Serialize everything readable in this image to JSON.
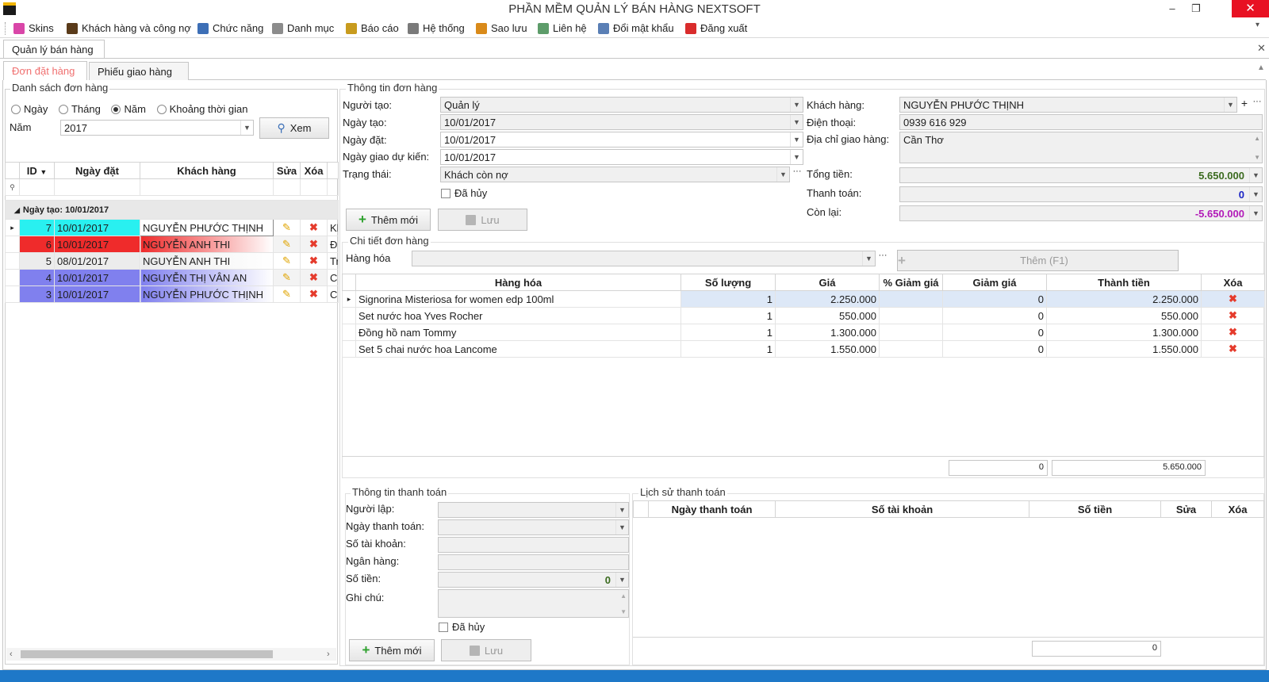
{
  "window": {
    "title": "PHẦN MỀM QUẢN LÝ BÁN HÀNG NEXTSOFT",
    "min": "–",
    "max": "❐",
    "close": "✕"
  },
  "menu": [
    {
      "label": "Skins",
      "icon": "palette-icon",
      "color": "#d946a8"
    },
    {
      "label": "Khách hàng và công nợ",
      "icon": "user-icon",
      "color": "#5a3b1a"
    },
    {
      "label": "Chức năng",
      "icon": "function-icon",
      "color": "#3d6fb6"
    },
    {
      "label": "Danh mục",
      "icon": "list-icon",
      "color": "#8c8c8c"
    },
    {
      "label": "Báo cáo",
      "icon": "report-icon",
      "color": "#c89b1e"
    },
    {
      "label": "Hệ thống",
      "icon": "gears-icon",
      "color": "#7a7a7a"
    },
    {
      "label": "Sao lưu",
      "icon": "backup-icon",
      "color": "#d98a1a"
    },
    {
      "label": "Liên hệ",
      "icon": "contact-icon",
      "color": "#5d9c6a"
    },
    {
      "label": "Đổi mật khẩu",
      "icon": "key-icon",
      "color": "#5a7fb5"
    },
    {
      "label": "Đăng xuất",
      "icon": "logout-icon",
      "color": "#d92c2c"
    }
  ],
  "doc_tab": "Quản lý bán hàng",
  "tabs": {
    "orders": "Đơn đặt hàng",
    "delivery": "Phiếu giao hàng"
  },
  "order_list": {
    "title": "Danh sách đơn hàng",
    "radios": [
      "Ngày",
      "Tháng",
      "Năm",
      "Khoảng thời gian"
    ],
    "year_label": "Năm",
    "year_value": "2017",
    "view_button": "Xem",
    "columns": [
      "ID",
      "Ngày đặt",
      "Khách hàng",
      "Sửa",
      "Xóa"
    ],
    "group_label": "Ngày tạo: 10/01/2017",
    "rows": [
      {
        "id": "7",
        "date": "10/01/2017",
        "customer": "NGUYỄN PHƯỚC THỊNH",
        "extra": "Kh",
        "bg": "#29f0f0"
      },
      {
        "id": "6",
        "date": "10/01/2017",
        "customer": "NGUYỄN ANH THI",
        "extra": "Đã",
        "bg": "#ef2b2b"
      },
      {
        "id": "5",
        "date": "08/01/2017",
        "customer": "NGUYỄN ANH THI",
        "extra": "Tr",
        "bg": "#ececec"
      },
      {
        "id": "4",
        "date": "10/01/2017",
        "customer": "NGUYỄN THỊ VÂN AN",
        "extra": "Ch",
        "bg": "#8080ee"
      },
      {
        "id": "3",
        "date": "10/01/2017",
        "customer": "NGUYỄN PHƯỚC THỊNH",
        "extra": "Ch",
        "bg": "#8080ee"
      }
    ]
  },
  "order_info": {
    "title": "Thông tin đơn hàng",
    "creator_label": "Người tạo:",
    "creator": "Quản lý",
    "created_label": "Ngày tạo:",
    "created": "10/01/2017",
    "order_date_label": "Ngày đặt:",
    "order_date": "10/01/2017",
    "delivery_label": "Ngày giao dự kiến:",
    "delivery": "10/01/2017",
    "status_label": "Trạng thái:",
    "status": "Khách còn nợ",
    "cancelled_label": "Đã hủy",
    "add_button": "Thêm mới",
    "save_button": "Lưu",
    "customer_label": "Khách hàng:",
    "customer": "NGUYỄN PHƯỚC THỊNH",
    "phone_label": "Điện thoại:",
    "phone": "0939 616 929",
    "address_label": "Địa chỉ giao hàng:",
    "address": "Cần Thơ",
    "total_label": "Tổng tiền:",
    "total": "5.650.000",
    "paid_label": "Thanh toán:",
    "paid": "0",
    "remaining_label": "Còn lại:",
    "remaining": "-5.650.000"
  },
  "order_detail": {
    "title": "Chi tiết đơn hàng",
    "product_label": "Hàng hóa",
    "add_button": "Thêm (F1)",
    "columns": [
      "Hàng hóa",
      "Số lượng",
      "Giá",
      "% Giảm giá",
      "Giảm giá",
      "Thành tiền",
      "Xóa"
    ],
    "rows": [
      {
        "name": "Signorina Misteriosa for women edp 100ml",
        "qty": "1",
        "price": "2.250.000",
        "pct": "",
        "disc": "0",
        "total": "2.250.000"
      },
      {
        "name": "Set nước hoa Yves Rocher",
        "qty": "1",
        "price": "550.000",
        "pct": "",
        "disc": "0",
        "total": "550.000"
      },
      {
        "name": "Đồng hồ nam Tommy",
        "qty": "1",
        "price": "1.300.000",
        "pct": "",
        "disc": "0",
        "total": "1.300.000"
      },
      {
        "name": "Set 5 chai nước hoa Lancome",
        "qty": "1",
        "price": "1.550.000",
        "pct": "",
        "disc": "0",
        "total": "1.550.000"
      }
    ],
    "sum_discount": "0",
    "sum_total": "5.650.000"
  },
  "payment_info": {
    "title": "Thông tin thanh toán",
    "creator_label": "Người lập:",
    "date_label": "Ngày thanh toán:",
    "account_label": "Số tài khoản:",
    "bank_label": "Ngân hàng:",
    "amount_label": "Số tiền:",
    "amount": "0",
    "note_label": "Ghi chú:",
    "cancelled_label": "Đã hủy",
    "add_button": "Thêm mới",
    "save_button": "Lưu"
  },
  "payment_history": {
    "title": "Lịch sử thanh toán",
    "columns": [
      "Ngày thanh toán",
      "Số tài khoản",
      "Số tiền",
      "Sửa",
      "Xóa"
    ],
    "sum": "0"
  }
}
